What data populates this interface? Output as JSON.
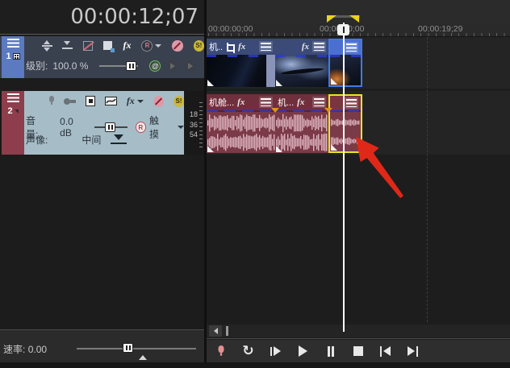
{
  "timecode": "00:00:12;07",
  "tracks": {
    "video": {
      "number": "1",
      "level_label": "级别:",
      "level_value": "100.0 %"
    },
    "audio": {
      "number": "2",
      "volume_label": "音量:",
      "volume_value": "0.0 dB",
      "automation_mode": "触摸",
      "pan_label": "声像:",
      "pan_value": "中间",
      "meter_ticks": [
        "18",
        "36",
        "54"
      ]
    }
  },
  "ruler": {
    "labels": [
      "00:00:00;00",
      "00:00:10;00",
      "00:00:19;29"
    ]
  },
  "clips": {
    "video": [
      {
        "label": "机.."
      },
      {
        "label": ""
      },
      {
        "label": ""
      }
    ],
    "audio": [
      {
        "label": "机舱..."
      },
      {
        "label": "机..."
      },
      {
        "label": ""
      }
    ]
  },
  "rate": {
    "label": "速率:",
    "value": "0.00"
  },
  "icons": {
    "fx": "fx",
    "solo": "S!",
    "automation_letter": "R",
    "at": "@",
    "loop_glyph": "↻"
  },
  "transport_buttons": [
    "record",
    "loop-playback",
    "play-from-start",
    "play",
    "pause",
    "stop",
    "go-to-start",
    "go-to-end"
  ],
  "colors": {
    "video_selection": "#3f7be5",
    "audio_selection": "#e8e428",
    "arrow": "#e02818",
    "loop_marker": "#e8d41c",
    "mute_pink": "#dc9aa8",
    "solo_yellow": "#c9b83a",
    "clip_video_header": "#3b4a76",
    "clip_audio_header": "#702f3c",
    "wave_bg": "#7b3a48",
    "wave_bar": "#dcb3bd",
    "track1_strip": "#5b7ac0",
    "track2_strip": "#8e3d4d",
    "track2_bg": "#a6bdc7"
  }
}
